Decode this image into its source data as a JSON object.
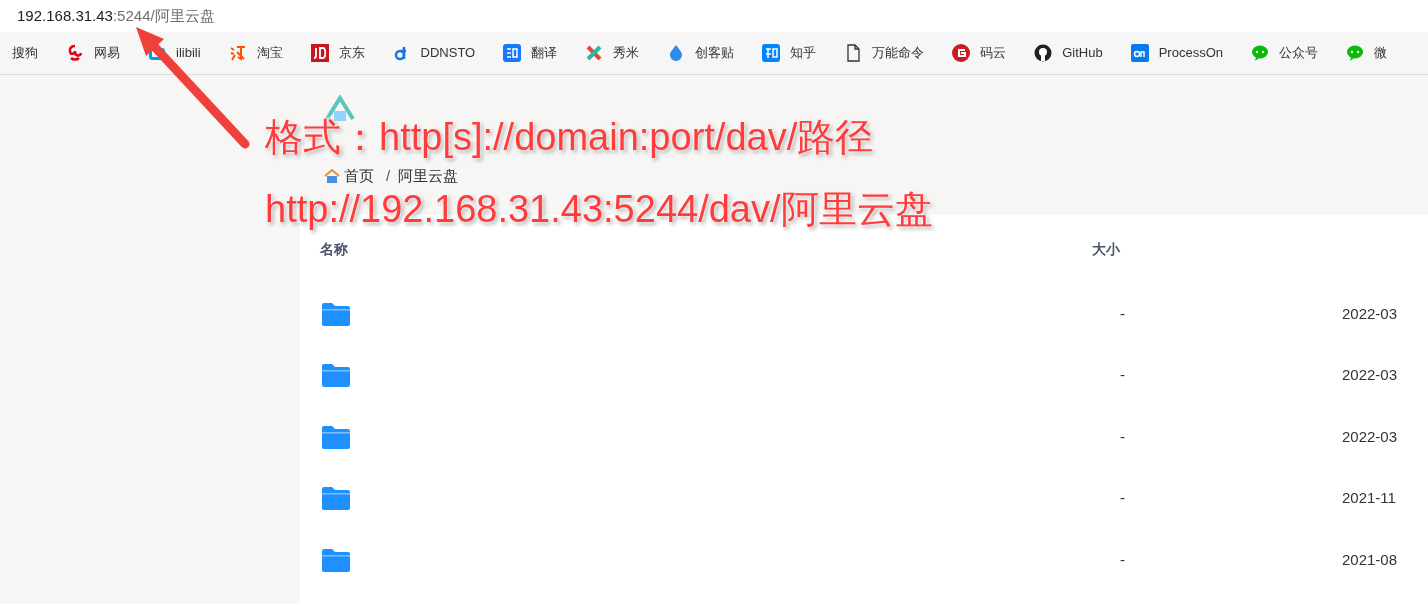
{
  "address_bar": {
    "host": "192.168.31.43",
    "path": ":5244/阿里云盘"
  },
  "bookmarks": [
    {
      "label": "搜狗"
    },
    {
      "label": "网易"
    },
    {
      "label": "ilibili"
    },
    {
      "label": "淘宝"
    },
    {
      "label": "京东"
    },
    {
      "label": "DDNSTO"
    },
    {
      "label": "翻译"
    },
    {
      "label": "秀米"
    },
    {
      "label": "创客贴"
    },
    {
      "label": "知乎"
    },
    {
      "label": "万能命令"
    },
    {
      "label": "码云"
    },
    {
      "label": "GitHub"
    },
    {
      "label": "ProcessOn"
    },
    {
      "label": "公众号"
    },
    {
      "label": "微"
    }
  ],
  "breadcrumb": {
    "items": [
      "首页",
      "阿里云盘"
    ],
    "separator": "/"
  },
  "table": {
    "columns": [
      "名称",
      "大小"
    ],
    "rows": [
      {
        "size": "-",
        "date": "2022-03"
      },
      {
        "size": "-",
        "date": "2022-03"
      },
      {
        "size": "-",
        "date": "2022-03"
      },
      {
        "size": "-",
        "date": "2021-11"
      },
      {
        "size": "-",
        "date": "2021-08"
      }
    ]
  },
  "annotation": {
    "lines": [
      "格式：http[s]://domain:port/dav/路径",
      "http://192.168.31.43:5244/dav/阿里云盘"
    ]
  }
}
